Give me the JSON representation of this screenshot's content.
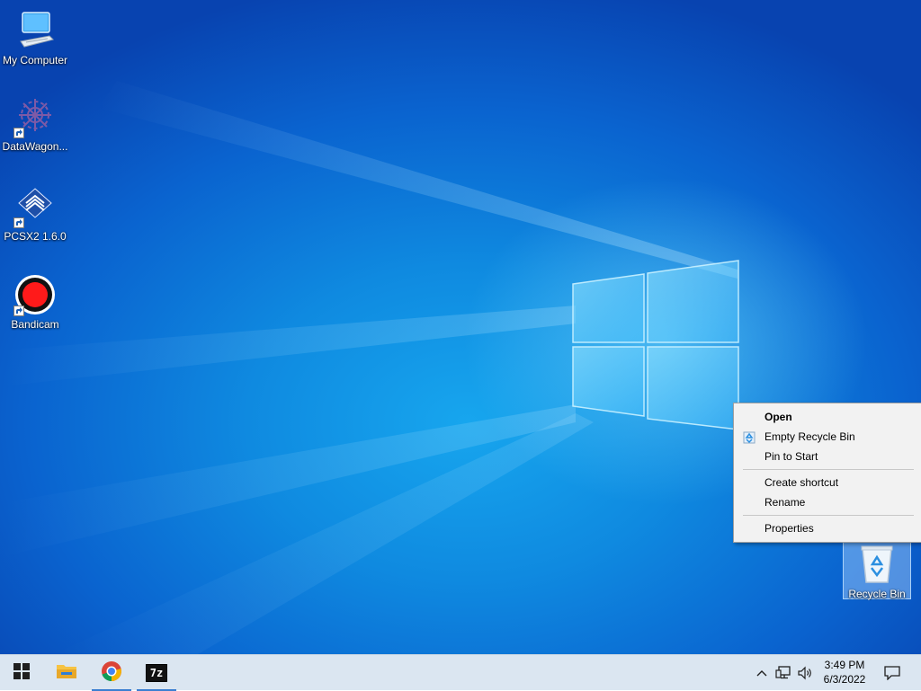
{
  "desktop": {
    "icons": [
      {
        "label": "My Computer",
        "icon": "computer-icon"
      },
      {
        "label": "DataWagon...",
        "icon": "datawagon-icon"
      },
      {
        "label": "PCSX2 1.6.0",
        "icon": "pcsx2-icon"
      },
      {
        "label": "Bandicam",
        "icon": "bandicam-icon"
      }
    ],
    "recycle_bin": {
      "label": "Recycle Bin",
      "icon": "recycle-bin-icon"
    }
  },
  "context_menu": {
    "items": [
      {
        "label": "Open",
        "bold": true
      },
      {
        "label": "Empty Recycle Bin",
        "icon": "recycle-icon"
      },
      {
        "label": "Pin to Start"
      },
      {
        "label": "Create shortcut"
      },
      {
        "label": "Rename"
      },
      {
        "label": "Properties"
      }
    ]
  },
  "taskbar": {
    "buttons": [
      {
        "name": "start",
        "icon": "windows-logo-icon"
      },
      {
        "name": "file-explorer",
        "icon": "folder-icon"
      },
      {
        "name": "chrome",
        "icon": "chrome-icon",
        "running": true
      },
      {
        "name": "7zip",
        "icon": "7zip-icon",
        "text": "7z",
        "running": true
      }
    ],
    "tray": {
      "icons": [
        "chevron-up-icon",
        "network-icon",
        "volume-icon"
      ],
      "time": "3:49 PM",
      "date": "6/3/2022",
      "notifications_icon": "notification-icon"
    }
  },
  "colors": {
    "accent": "#3b7fd1",
    "taskbar_bg": "#dbe6f1",
    "menu_bg": "#f2f2f2"
  }
}
